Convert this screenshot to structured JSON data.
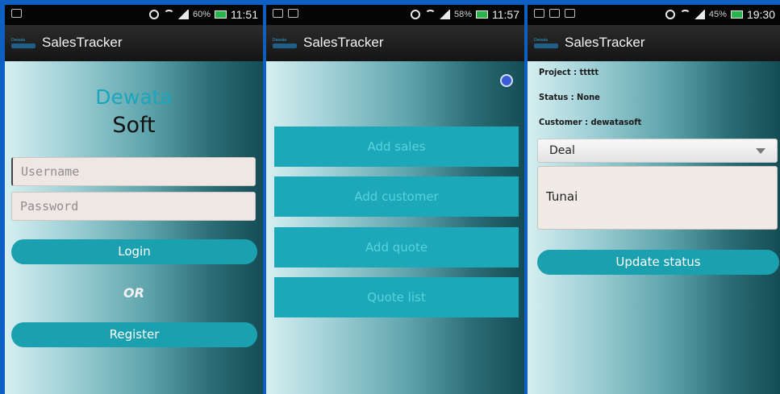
{
  "screens": [
    {
      "statusbar": {
        "battery_pct": "60%",
        "time": "11:51"
      },
      "actionbar": {
        "title": "SalesTracker",
        "logo_text": "Dewata"
      },
      "brand": {
        "line1": "Dewata",
        "line2": "Soft"
      },
      "username": {
        "placeholder": "Username"
      },
      "password": {
        "placeholder": "Password"
      },
      "login_label": "Login",
      "or_label": "OR",
      "register_label": "Register"
    },
    {
      "statusbar": {
        "battery_pct": "58%",
        "time": "11:57"
      },
      "actionbar": {
        "title": "SalesTracker",
        "logo_text": "Dewata"
      },
      "menu": [
        "Add sales",
        "Add customer",
        "Add quote",
        "Quote list"
      ]
    },
    {
      "statusbar": {
        "battery_pct": "45%",
        "time": "19:30"
      },
      "actionbar": {
        "title": "SalesTracker",
        "logo_text": "Dewata"
      },
      "project": "Project : ttttt",
      "status": "Status : None",
      "customer": "Customer : dewatasoft",
      "select_value": "Deal",
      "textarea_value": "Tunai",
      "update_label": "Update status"
    }
  ],
  "colors": {
    "accent": "#1aa0ae",
    "menu_button": "#1ca8b8",
    "background": "#0e5fc4",
    "brand_blue": "#1aa6bd"
  },
  "icons": [
    "notification-icon",
    "alarm-icon",
    "wifi-icon",
    "signal-icon",
    "battery-icon",
    "settings-icon",
    "dropdown-arrow-icon"
  ]
}
